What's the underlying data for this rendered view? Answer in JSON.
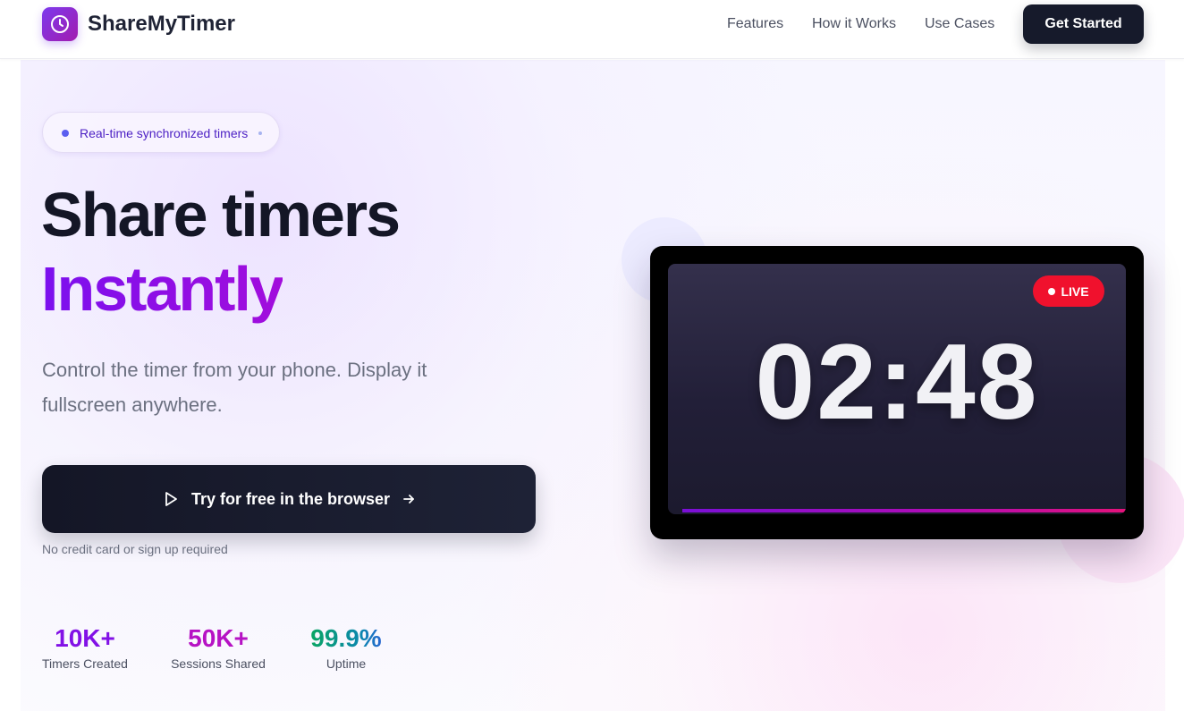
{
  "header": {
    "brand": "ShareMyTimer",
    "logo_icon": "clock-icon",
    "nav": {
      "features": "Features",
      "how_it_works": "How it Works",
      "use_cases": "Use Cases"
    },
    "cta_label": "Get Started"
  },
  "hero": {
    "badge": "Real-time synchronized timers",
    "headline_line1": "Share timers",
    "headline_line2": "Instantly",
    "subtitle": "Control the timer from your phone. Display it fullscreen anywhere.",
    "cta_label": "Try for free in the browser",
    "cta_icons": [
      "play-icon",
      "arrow-right-icon"
    ],
    "cta_note": "No credit card or sign up required"
  },
  "stats": [
    {
      "value": "10K+",
      "label": "Timers Created"
    },
    {
      "value": "50K+",
      "label": "Sessions Shared"
    },
    {
      "value": "99.9%",
      "label": "Uptime"
    }
  ],
  "timer_preview": {
    "live_label": "LIVE",
    "time": "02:48",
    "progress": 1.0
  },
  "colors": {
    "accent_purple": "#8211e6",
    "accent_magenta": "#b612c4",
    "dark_button": "#161a2b",
    "live_red": "#f0112d",
    "uptime_green": "#0aa85c"
  }
}
